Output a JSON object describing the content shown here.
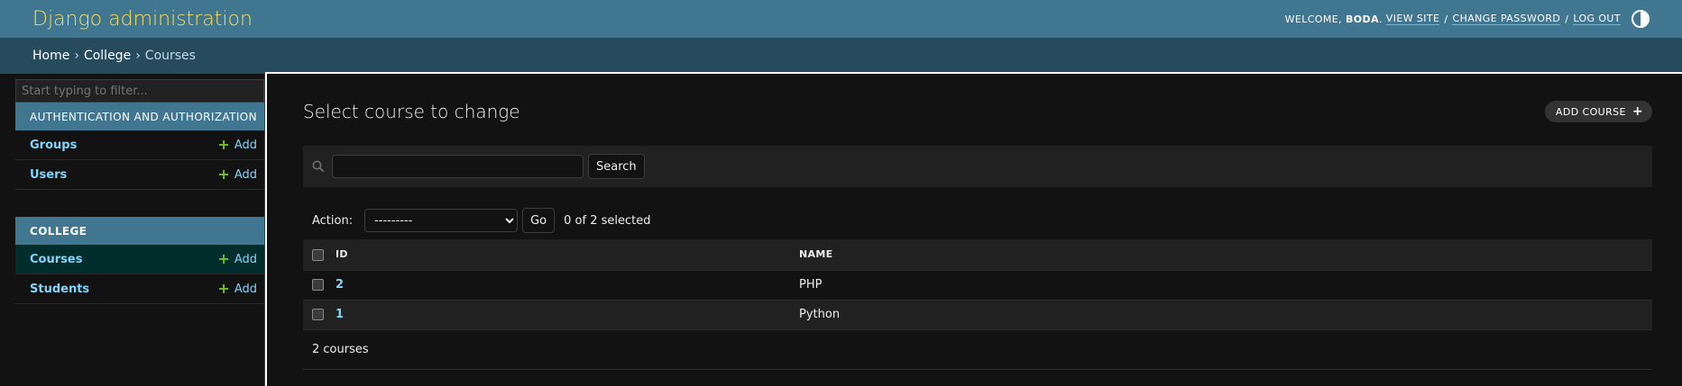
{
  "header": {
    "site_name": "Django administration",
    "welcome": "Welcome,",
    "username": "Boda",
    "view_site": "View site",
    "change_password": "Change password",
    "log_out": "Log out",
    "separator": "/"
  },
  "breadcrumbs": {
    "home": "Home",
    "app": "College",
    "current": "Courses",
    "separator": "›"
  },
  "sidebar": {
    "filter_placeholder": "Start typing to filter...",
    "apps": [
      {
        "name": "Authentication and Authorization",
        "models": [
          {
            "label": "Groups",
            "add": "Add"
          },
          {
            "label": "Users",
            "add": "Add"
          }
        ]
      },
      {
        "name": "College",
        "models": [
          {
            "label": "Courses",
            "add": "Add"
          },
          {
            "label": "Students",
            "add": "Add"
          }
        ]
      }
    ]
  },
  "content": {
    "title": "Select course to change",
    "add_button": "Add course",
    "search_button": "Search",
    "search_value": "",
    "action_label": "Action:",
    "action_selected": "---------",
    "go_button": "Go",
    "selected_counter": "0 of 2 selected",
    "columns": [
      "ID",
      "Name"
    ],
    "rows": [
      {
        "id": "2",
        "name": "PHP"
      },
      {
        "id": "1",
        "name": "Python"
      }
    ],
    "paginator": "2 courses"
  },
  "colors": {
    "header_bg": "#417690",
    "branding": "#f5dd5d",
    "breadcrumbs_bg": "#264b5d",
    "link": "#81d4fa",
    "add_plus": "#70bf2b",
    "current_row_bg": "#002c2c"
  },
  "icons": {
    "theme": "theme-toggle-icon",
    "search": "search-icon",
    "add": "plus-icon"
  }
}
